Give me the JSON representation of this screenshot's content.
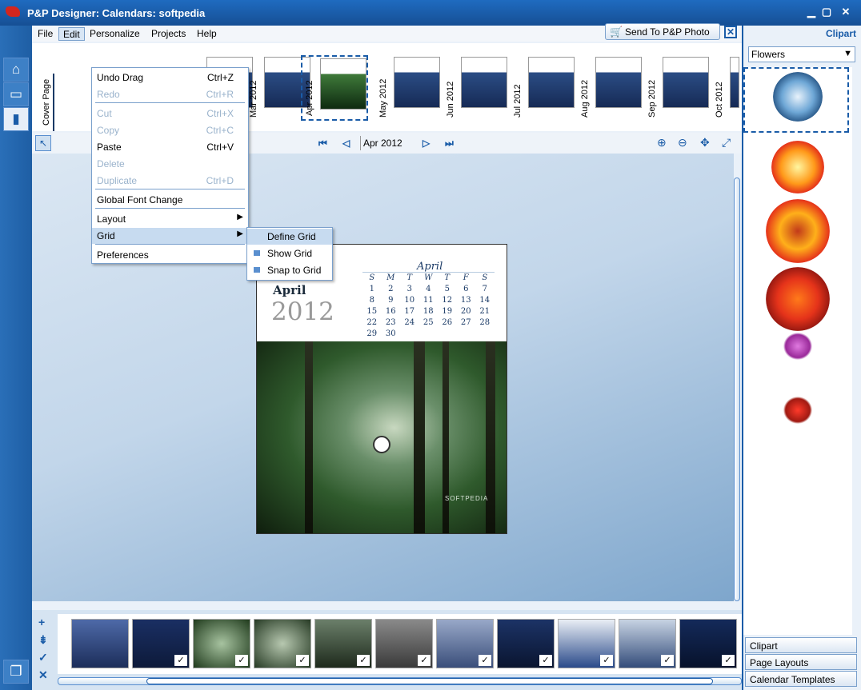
{
  "window": {
    "title": "P&P Designer: Calendars: softpedia"
  },
  "menubar": {
    "file": "File",
    "edit": "Edit",
    "personalize": "Personalize",
    "projects": "Projects",
    "help": "Help"
  },
  "send": {
    "label": "Send To  P&P Photo"
  },
  "strip": {
    "cover": "Cover Page",
    "thumbs": [
      {
        "label": ""
      },
      {
        "label": "Mar  2012"
      },
      {
        "label": "Apr  2012"
      },
      {
        "label": "May  2012"
      },
      {
        "label": "Jun  2012"
      },
      {
        "label": "Jul  2012"
      },
      {
        "label": "Aug  2012"
      },
      {
        "label": "Sep  2012"
      },
      {
        "label": "Oct  2012"
      }
    ]
  },
  "nav": {
    "current": "Apr  2012"
  },
  "edit_menu": [
    {
      "label": "Undo Drag",
      "shortcut": "Ctrl+Z"
    },
    {
      "label": "Redo",
      "shortcut": "Ctrl+R"
    },
    {
      "label": "Cut",
      "shortcut": "Ctrl+X"
    },
    {
      "label": "Copy",
      "shortcut": "Ctrl+C"
    },
    {
      "label": "Paste",
      "shortcut": "Ctrl+V"
    },
    {
      "label": "Delete",
      "shortcut": ""
    },
    {
      "label": "Duplicate",
      "shortcut": "Ctrl+D"
    },
    {
      "label": "Global Font Change",
      "shortcut": ""
    },
    {
      "label": "Layout",
      "shortcut": ""
    },
    {
      "label": "Grid",
      "shortcut": ""
    },
    {
      "label": "Preferences",
      "shortcut": ""
    }
  ],
  "grid_menu": [
    {
      "label": "Define Grid"
    },
    {
      "label": "Show Grid"
    },
    {
      "label": "Snap to Grid"
    }
  ],
  "page": {
    "month": "April",
    "year": "2012",
    "cal_title": "April",
    "dow": [
      "S",
      "M",
      "T",
      "W",
      "T",
      "F",
      "S"
    ],
    "days": [
      "1",
      "2",
      "3",
      "4",
      "5",
      "6",
      "7",
      "8",
      "9",
      "10",
      "11",
      "12",
      "13",
      "14",
      "15",
      "16",
      "17",
      "18",
      "19",
      "20",
      "21",
      "22",
      "23",
      "24",
      "25",
      "26",
      "27",
      "28",
      "29",
      "30"
    ],
    "photo_text": "SOFTPEDIA"
  },
  "right": {
    "header": "Clipart",
    "category": "Flowers",
    "tabs": [
      "Clipart",
      "Page Layouts",
      "Calendar Templates"
    ]
  }
}
